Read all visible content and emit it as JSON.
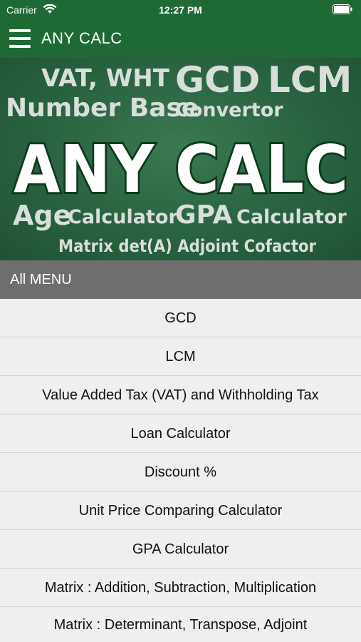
{
  "status_bar": {
    "carrier": "Carrier",
    "time": "12:27 PM",
    "wifi_icon": "wifi-icon",
    "battery_icon": "battery-icon"
  },
  "app_bar": {
    "title": "ANY CALC",
    "menu_icon": "hamburger-menu-icon",
    "color": "#1f6a34"
  },
  "banner": {
    "line1_a": "VAT, WHT",
    "line1_b": "GCD",
    "line1_c": "LCM",
    "line2_a": "Number Base",
    "line2_b": "Convertor",
    "headline": "ANY CALC",
    "line4_a": "Age",
    "line4_b": "Calculator",
    "line4_c": "GPA",
    "line4_d": "Calculator",
    "line5": "Matrix det(A) Adjoint Cofactor"
  },
  "section_header": {
    "label": "All MENU",
    "color": "#6e6e6e"
  },
  "menu": {
    "items": [
      "GCD",
      "LCM",
      "Value Added Tax (VAT) and Withholding Tax",
      "Loan Calculator",
      "Discount %",
      "Unit Price Comparing Calculator",
      "GPA Calculator",
      "Matrix : Addition, Subtraction, Multiplication",
      "Matrix : Determinant, Transpose, Adjoint"
    ]
  }
}
